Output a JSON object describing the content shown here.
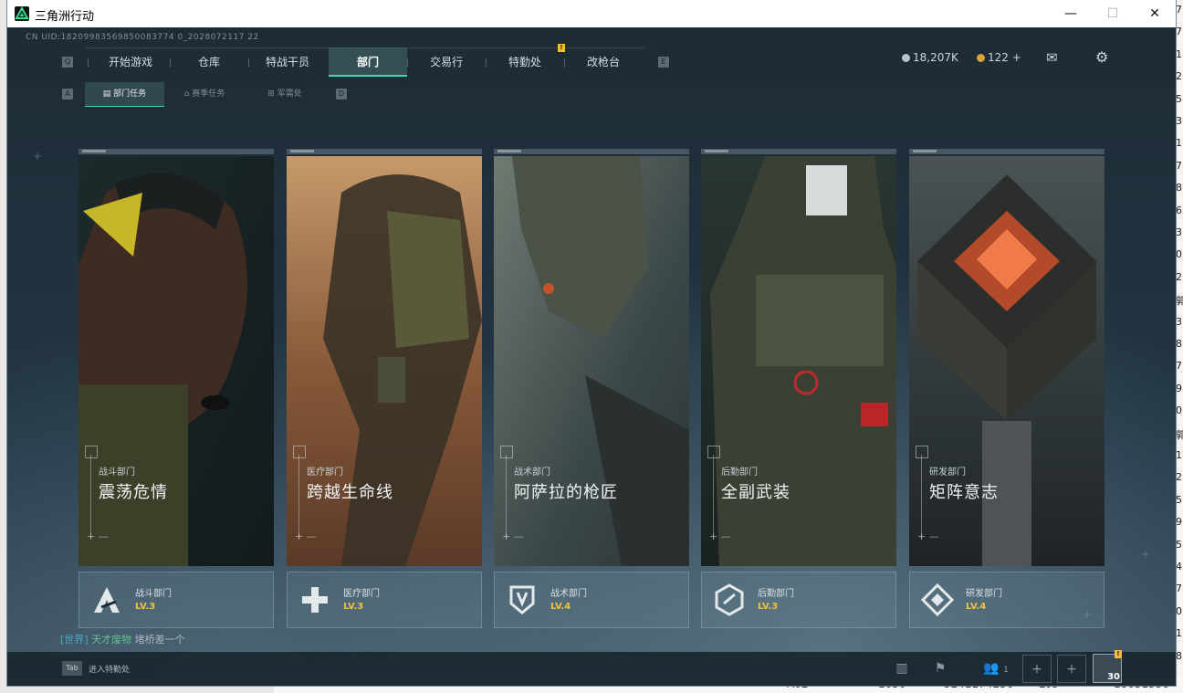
{
  "window": {
    "title": "三角洲行动",
    "minimize": "—",
    "maximize": "☐",
    "close": "✕"
  },
  "game": {
    "uid": "CN UID:18209983569850083774 0_2028072117 22",
    "nav": {
      "left_key": "Q",
      "right_key": "E",
      "tabs": [
        {
          "label": "开始游戏"
        },
        {
          "label": "仓库"
        },
        {
          "label": "特战干员"
        },
        {
          "label": "部门"
        },
        {
          "label": "交易行"
        },
        {
          "label": "特勤处"
        },
        {
          "label": "改枪台"
        }
      ],
      "badge": "!"
    },
    "subnav": {
      "left_key": "A",
      "right_key": "D",
      "tabs": [
        {
          "label": "部门任务"
        },
        {
          "label": "赛季任务"
        },
        {
          "label": "军需处"
        }
      ]
    },
    "currency": {
      "silver": "18,207K",
      "gold": "122",
      "gold_add": "+"
    },
    "cards": [
      {
        "dept": "战斗部门",
        "name": "震荡危情",
        "footer_dept": "战斗部门",
        "level": "LV.3"
      },
      {
        "dept": "医疗部门",
        "name": "跨越生命线",
        "footer_dept": "医疗部门",
        "level": "LV.3"
      },
      {
        "dept": "战术部门",
        "name": "阿萨拉的枪匠",
        "footer_dept": "战术部门",
        "level": "LV.4"
      },
      {
        "dept": "后勤部门",
        "name": "全副武装",
        "footer_dept": "后勤部门",
        "level": "LV.3"
      },
      {
        "dept": "研发部门",
        "name": "矩阵意志",
        "footer_dept": "研发部门",
        "level": "LV.4"
      }
    ],
    "chat": {
      "channel": "[世界]",
      "sender": "天才废物",
      "message": "堵桥差一个"
    },
    "bottom": {
      "tab_key": "Tab",
      "tab_label": "进入特勤处",
      "friends_count": "1",
      "player_level": "30",
      "notify_badge": "!"
    }
  },
  "desktop": {
    "right_chars": [
      "7",
      "7",
      "1",
      "2",
      "5",
      "3",
      "1",
      "7",
      "8",
      "6",
      "3",
      "0",
      "2",
      "郭",
      "3",
      "8",
      "7",
      "9",
      "0",
      "郭",
      "1",
      "2",
      "5",
      "9",
      "5",
      "4",
      "7",
      "0",
      "1",
      "8"
    ],
    "bottom_row": [
      "A02",
      "1650",
      "3241174256",
      "L63",
      "18651358"
    ]
  },
  "colors": {
    "accent": "#46d6a7",
    "level": "#f1c23a",
    "chat_channel": "#4ea6c8",
    "chat_sender": "#5fc28e"
  }
}
